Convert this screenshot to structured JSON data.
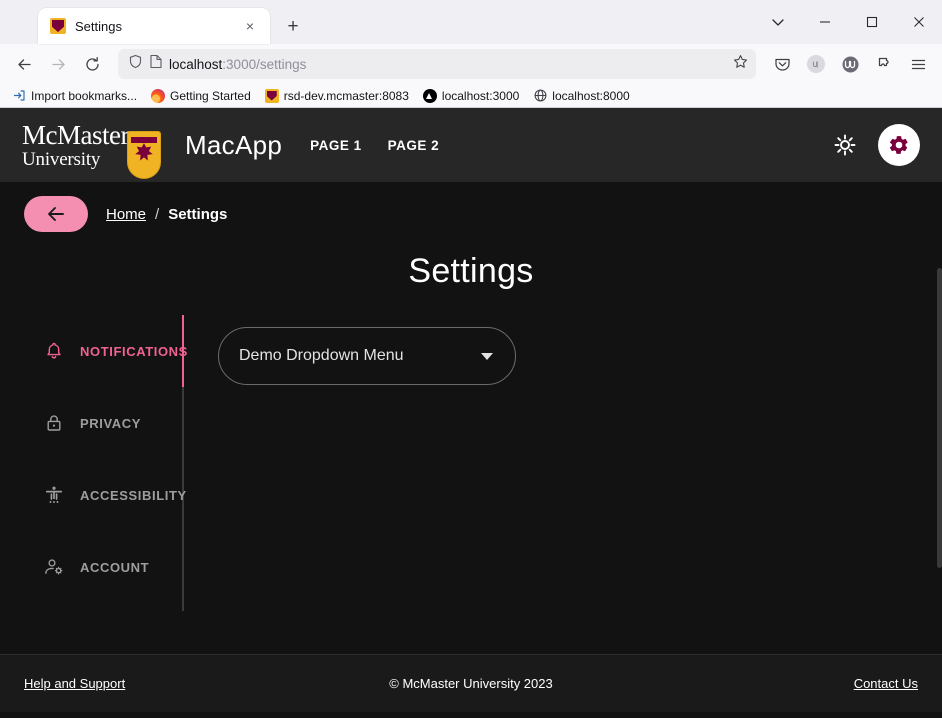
{
  "browser": {
    "tab": {
      "title": "Settings",
      "favicon": "mcmaster-crest-icon",
      "close_label": "×"
    },
    "new_tab_label": "+",
    "window_controls": {
      "list_tabs": "chevron-down-icon",
      "minimize": "–",
      "maximize": "□",
      "close": "✕"
    },
    "nav": {
      "back": "←",
      "forward": "→",
      "reload": "↻"
    },
    "url": {
      "host": "localhost",
      "path": ":3000/settings",
      "shield": "shield-icon",
      "page": "page-icon",
      "bookmark": "star-icon"
    },
    "toolbar_icons": [
      "pocket-icon",
      "account-icon",
      "wave-extension-icon",
      "extensions-icon",
      "app-menu-icon"
    ],
    "bookmarks": [
      {
        "label": "Import bookmarks...",
        "icon": "import-icon"
      },
      {
        "label": "Getting Started",
        "icon": "firefox-icon"
      },
      {
        "label": "rsd-dev.mcmaster:8083",
        "icon": "mcmaster-crest-icon"
      },
      {
        "label": "localhost:3000",
        "icon": "triangle-icon"
      },
      {
        "label": "localhost:8000",
        "icon": "globe-icon"
      }
    ]
  },
  "app": {
    "brand": {
      "line1": "McMaster",
      "line2": "University",
      "crest": "mcmaster-crest-icon"
    },
    "title": "MacApp",
    "nav_links": [
      {
        "label": "PAGE 1"
      },
      {
        "label": "PAGE 2"
      }
    ],
    "header_actions": [
      {
        "name": "brightness-toggle",
        "icon": "sun-icon"
      },
      {
        "name": "settings-button",
        "icon": "gear-icon"
      }
    ],
    "breadcrumb": {
      "back_icon": "arrow-left-icon",
      "home": "Home",
      "separator": "/",
      "current": "Settings"
    },
    "page_title": "Settings",
    "tabs": [
      {
        "label": "NOTIFICATIONS",
        "icon": "bell-icon",
        "active": true
      },
      {
        "label": "PRIVACY",
        "icon": "lock-icon",
        "active": false
      },
      {
        "label": "ACCESSIBILITY",
        "icon": "accessibility-icon",
        "active": false
      },
      {
        "label": "ACCOUNT",
        "icon": "manage-account-icon",
        "active": false
      }
    ],
    "dropdown": {
      "label": "Demo Dropdown Menu",
      "caret": "chevron-down-icon"
    },
    "footer": {
      "help": "Help and Support",
      "copyright": "© McMaster University 2023",
      "contact": "Contact Us"
    },
    "colors": {
      "accent_pink": "#f06292",
      "back_button_pink": "#f48fb1",
      "maroon": "#7a003c",
      "gold": "#f0b323",
      "header_bg": "#272727",
      "body_bg": "#121212",
      "footer_bg": "#1a1a1a"
    }
  }
}
